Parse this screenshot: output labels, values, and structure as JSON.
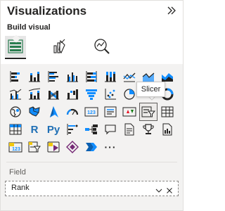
{
  "pane": {
    "title": "Visualizations",
    "build_label": "Build visual"
  },
  "colors": {
    "brand_yellow": "#f2c80f",
    "brand_blue": "#118dff",
    "icon_dark": "#252423",
    "icon_grey": "#605e5c",
    "text_blue": "#1f6fb5"
  },
  "modes": [
    {
      "icon": "build-visual-icon",
      "active": true
    },
    {
      "icon": "format-visual-icon",
      "active": false
    },
    {
      "icon": "analytics-icon",
      "active": false
    }
  ],
  "gallery": [
    [
      "stacked-bar-chart-icon",
      "stacked-column-chart-icon",
      "clustered-bar-chart-icon",
      "clustered-column-chart-icon",
      "100-stacked-bar-chart-icon",
      "100-stacked-column-chart-icon",
      "line-chart-icon",
      "area-chart-icon",
      "stacked-area-chart-icon"
    ],
    [
      "line-clustered-column-chart-icon",
      "line-stacked-column-chart-icon",
      "ribbon-chart-icon",
      "waterfall-chart-icon",
      "funnel-chart-icon",
      "scatter-chart-icon",
      "pie-chart-icon",
      "slicer-icon",
      "hidden-under-tooltip"
    ],
    [
      "map-icon",
      "filled-map-icon",
      "azure-map-icon",
      "gauge-icon",
      "card-icon",
      "multi-row-card-icon",
      "kpi-icon",
      "slicer-icon",
      "table-icon"
    ],
    [
      "matrix-icon",
      "r-script-visual-icon",
      "python-visual-icon",
      "key-influencers-icon",
      "decomposition-tree-icon",
      "qa-icon",
      "smart-narrative-icon",
      "goals-icon",
      "paginated-report-icon"
    ],
    [
      "new-card-icon",
      "new-slicer-icon",
      "power-apps-icon",
      "power-automate-icon",
      "narrative-icon",
      "more-visuals-icon"
    ]
  ],
  "tooltip": {
    "text": "Slicer"
  },
  "r_label": "R",
  "py_label": "Py",
  "more_label": "···",
  "field": {
    "label": "Field",
    "value": "Rank"
  }
}
